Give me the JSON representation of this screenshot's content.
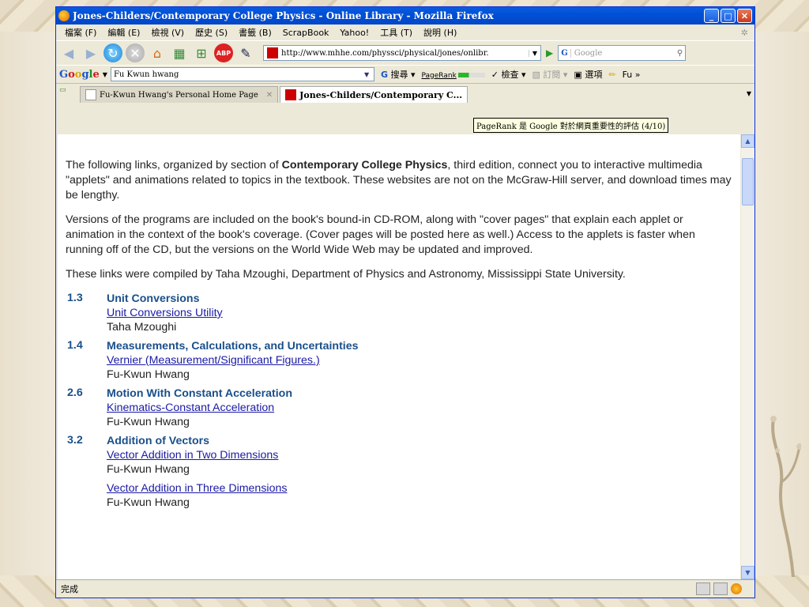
{
  "window": {
    "title": "Jones-Childers/Contemporary College Physics - Online Library - Mozilla Firefox",
    "minimize": "_",
    "maximize": "□",
    "close": "✕"
  },
  "menu": [
    "檔案 (F)",
    "編輯 (E)",
    "檢視 (V)",
    "歷史 (S)",
    "書籤 (B)",
    "ScrapBook",
    "Yahoo!",
    "工具 (T)",
    "說明 (H)"
  ],
  "nav": {
    "url": "http://www.mhhe.com/physsci/physical/jones/onlibr.",
    "abp_label": "ABP",
    "search_engine_label": "G",
    "search_placeholder": "Google"
  },
  "google_toolbar": {
    "logo": [
      "G",
      "o",
      "o",
      "g",
      "l",
      "e"
    ],
    "query": "Fu Kwun hwang",
    "search_label": "搜尋",
    "pagerank_label": "PageRank",
    "check_label": "檢查",
    "subscribe_label": "訂閱",
    "options_label": "選項",
    "user_label": "Fu »"
  },
  "tabs": [
    {
      "label": "Fu-Kwun Hwang's Personal Home Page",
      "active": false
    },
    {
      "label": "Jones-Childers/Contemporary C...",
      "active": true
    }
  ],
  "tooltip": "PageRank 是 Google 對於網頁重要性的評估 (4/10)",
  "content": {
    "para1_before": "The following links, organized by section of ",
    "para1_bold": "Contemporary College Physics",
    "para1_after": ", third edition, connect you to interactive multimedia \"applets\" and animations related to topics in the textbook. These websites are not on the McGraw-Hill server, and download times may be lengthy.",
    "para2": "Versions of the programs are included on the book's bound-in CD-ROM, along with \"cover pages\" that explain each applet or animation in the context of the book's coverage. (Cover pages will be posted here as well.) Access to the applets is faster when running off of the CD, but the versions on the World Wide Web may be updated and improved.",
    "para3": "These links were compiled by Taha Mzoughi, Department of Physics and Astronomy, Mississippi State University.",
    "entries": [
      {
        "num": "1.3",
        "title": "Unit Conversions",
        "links": [
          {
            "text": "Unit Conversions Utility",
            "author": "Taha Mzoughi"
          }
        ]
      },
      {
        "num": "1.4",
        "title": "Measurements, Calculations, and Uncertainties",
        "links": [
          {
            "text": "Vernier (Measurement/Significant Figures.)",
            "author": "Fu-Kwun Hwang"
          }
        ]
      },
      {
        "num": "2.6",
        "title": "Motion With Constant Acceleration",
        "links": [
          {
            "text": "Kinematics-Constant Acceleration",
            "author": "Fu-Kwun Hwang"
          }
        ]
      },
      {
        "num": "3.2",
        "title": "Addition of Vectors",
        "links": [
          {
            "text": "Vector Addition in Two Dimensions",
            "author": "Fu-Kwun Hwang"
          },
          {
            "text": "Vector Addition in Three Dimensions",
            "author": "Fu-Kwun Hwang"
          }
        ]
      }
    ]
  },
  "status": "完成"
}
